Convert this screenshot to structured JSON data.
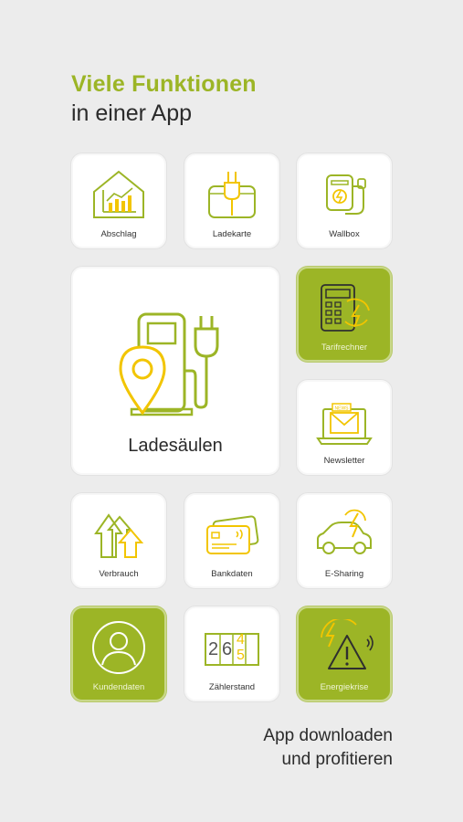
{
  "headline": {
    "line1": "Viele Funktionen",
    "line2": "in einer App"
  },
  "tiles": {
    "abschlag": {
      "label": "Abschlag",
      "icon": "house-chart-icon"
    },
    "ladekarte": {
      "label": "Ladekarte",
      "icon": "charging-card-icon"
    },
    "wallbox": {
      "label": "Wallbox",
      "icon": "wallbox-icon"
    },
    "ladesaeulen": {
      "label": "Ladesäulen",
      "icon": "charging-station-pin-icon"
    },
    "tarifrechner": {
      "label": "Tarifrechner",
      "icon": "calculator-icon"
    },
    "newsletter": {
      "label": "Newsletter",
      "icon": "laptop-mail-icon"
    },
    "verbrauch": {
      "label": "Verbrauch",
      "icon": "arrows-up-icon"
    },
    "bankdaten": {
      "label": "Bankdaten",
      "icon": "bank-cards-icon"
    },
    "esharing": {
      "label": "E-Sharing",
      "icon": "electric-car-icon"
    },
    "kundendaten": {
      "label": "Kundendaten",
      "icon": "user-circle-icon"
    },
    "zaehlerstand": {
      "label": "Zählerstand",
      "icon": "meter-digits-icon",
      "digits": [
        "2",
        "6",
        "4",
        "5"
      ]
    },
    "energiekrise": {
      "label": "Energiekrise",
      "icon": "warning-bolt-icon"
    }
  },
  "cta": {
    "line1": "App downloaden",
    "line2": "und profitieren"
  },
  "colors": {
    "accent": "#9cb526",
    "icon_yellow": "#f2c500",
    "background": "#ececec"
  }
}
